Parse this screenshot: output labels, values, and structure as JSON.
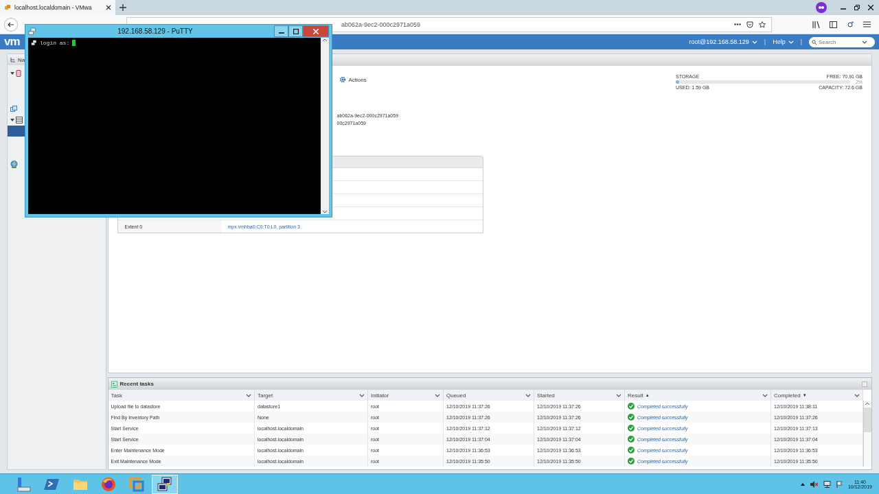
{
  "browser": {
    "tab": {
      "title": "localhost.localdomain - VMwa"
    },
    "url_tail": "ab062a-9ec2-000c2971a059"
  },
  "header": {
    "logo": "vm",
    "separators": [
      "|",
      "|"
    ],
    "user": "root@192.168.58.129",
    "help": "Help",
    "search": {
      "placeholder": "Search"
    }
  },
  "navigator": {
    "title": "Na"
  },
  "datastore": {
    "actions": "Actions",
    "details": [
      "ab062a-9ec2-000c2971a059",
      "00c2971a059"
    ],
    "storage": {
      "label": "STORAGE",
      "free": "FREE: 70.91 GB",
      "percent": "2%",
      "level": 0.02,
      "used": "USED: 1.59 GB",
      "capacity": "CAPACITY: 72.6 GB"
    },
    "table": {
      "rows": [
        {
          "label": "Extent 0",
          "value": "mpx.vmhba0:C0:T0:L0, partition 3"
        }
      ]
    }
  },
  "recent_tasks": {
    "title": "Recent tasks",
    "columns": [
      {
        "label": "Task"
      },
      {
        "label": "Target"
      },
      {
        "label": "Initiator"
      },
      {
        "label": "Queued"
      },
      {
        "label": "Started"
      },
      {
        "label": "Result",
        "sort_arrow": "▲"
      },
      {
        "label": "Completed",
        "sort_arrow": "▼"
      }
    ],
    "rows": [
      {
        "task": "Upload file to datastore",
        "target": "datastore1",
        "initiator": "root",
        "queued": "12/10/2019 11:37:26",
        "started": "12/10/2019 11:37:26",
        "result": "Completed successfully",
        "completed": "12/10/2019 11:38:11"
      },
      {
        "task": "Find By Inventory Path",
        "target": "None",
        "initiator": "root",
        "queued": "12/10/2019 11:37:26",
        "started": "12/10/2019 11:37:26",
        "result": "Completed successfully",
        "completed": "12/10/2019 11:37:26"
      },
      {
        "task": "Start Service",
        "target": "localhost.localdomain",
        "initiator": "root",
        "queued": "12/10/2019 11:37:12",
        "started": "12/10/2019 11:37:12",
        "result": "Completed successfully",
        "completed": "12/10/2019 11:37:13"
      },
      {
        "task": "Start Service",
        "target": "localhost.localdomain",
        "initiator": "root",
        "queued": "12/10/2019 11:37:04",
        "started": "12/10/2019 11:37:04",
        "result": "Completed successfully",
        "completed": "12/10/2019 11:37:04"
      },
      {
        "task": "Enter Maintenance Mode",
        "target": "localhost.localdomain",
        "initiator": "root",
        "queued": "12/10/2019 11:36:53",
        "started": "12/10/2019 11:36:53",
        "result": "Completed successfully",
        "completed": "12/10/2019 11:36:53"
      },
      {
        "task": "Exit Maintenance Mode",
        "target": "localhost.localdomain",
        "initiator": "root",
        "queued": "12/10/2019 11:35:50",
        "started": "12/10/2019 11:35:50",
        "result": "Completed successfully",
        "completed": "12/10/2019 11:35:50"
      }
    ]
  },
  "putty": {
    "title": "192.168.58.129 - PuTTY",
    "prompt": "login as:"
  },
  "taskbar": {
    "apps": [
      {
        "kind": "server-manager",
        "selected": false
      },
      {
        "kind": "powershell",
        "selected": false
      },
      {
        "kind": "explorer",
        "selected": false
      },
      {
        "kind": "firefox",
        "selected": false
      },
      {
        "kind": "vmware",
        "selected": false
      },
      {
        "kind": "putty",
        "selected": true
      }
    ],
    "time": "11:40",
    "date": "10/12/2019"
  }
}
